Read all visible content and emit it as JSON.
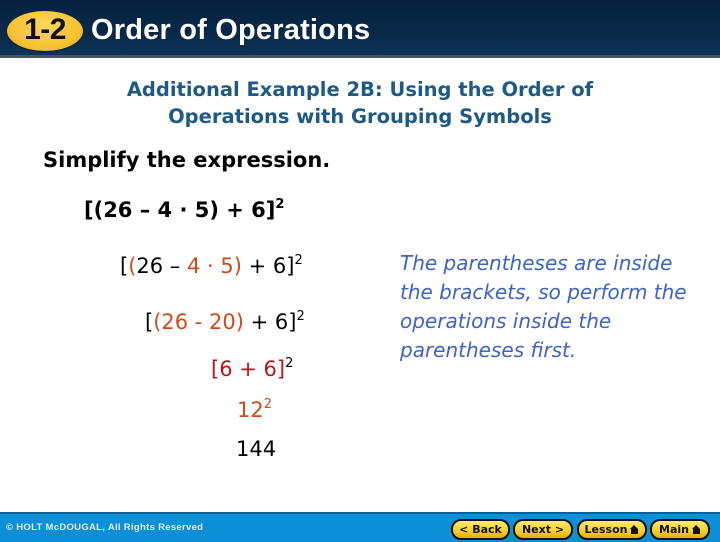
{
  "header": {
    "lesson_number": "1-2",
    "title": "Order of Operations",
    "colors": {
      "background": "#0a2a4a",
      "badge": "#f5c12f",
      "title_text": "#ffffff"
    }
  },
  "subtitle": {
    "line1": "Additional Example 2B: Using the Order of",
    "line2": "Operations with Grouping Symbols",
    "color": "#1e5a86"
  },
  "instruction": "Simplify the expression.",
  "expression": {
    "base": "[(26 – 4 · 5) + 6]",
    "exponent": "2"
  },
  "steps": [
    {
      "parts": [
        {
          "text": "[",
          "color": "black"
        },
        {
          "text": "(",
          "color": "orange"
        },
        {
          "text": "26 – ",
          "color": "black"
        },
        {
          "text": "4 · 5)",
          "color": "orange"
        },
        {
          "text": " + 6]",
          "color": "black"
        }
      ],
      "exponent": "2"
    },
    {
      "parts": [
        {
          "text": "[",
          "color": "black"
        },
        {
          "text": "(26 - 20)",
          "color": "orange"
        },
        {
          "text": " + 6]",
          "color": "black"
        }
      ],
      "exponent": "2"
    },
    {
      "parts": [
        {
          "text": "[6 + 6]",
          "color": "darkred"
        }
      ],
      "exponent": "2"
    },
    {
      "parts": [
        {
          "text": "12",
          "color": "orange"
        }
      ],
      "exponent": "2"
    },
    {
      "parts": [
        {
          "text": "144",
          "color": "black"
        }
      ]
    }
  ],
  "note": "The parentheses are inside the brackets, so perform the operations inside the parentheses first.",
  "colors": {
    "orange": "#d14a1c",
    "darkred": "#b5161b",
    "note": "#3f63c2"
  },
  "footer": {
    "copyright": "© HOLT McDOUGAL, All Rights Reserved",
    "buttons": {
      "back": {
        "label": "Back",
        "icon": "chevron-left-icon"
      },
      "next": {
        "label": "Next",
        "icon": "chevron-right-icon"
      },
      "lesson": {
        "label": "Lesson",
        "icon": "home-icon"
      },
      "main": {
        "label": "Main",
        "icon": "home-icon"
      }
    },
    "background": "#0c8fd6"
  }
}
